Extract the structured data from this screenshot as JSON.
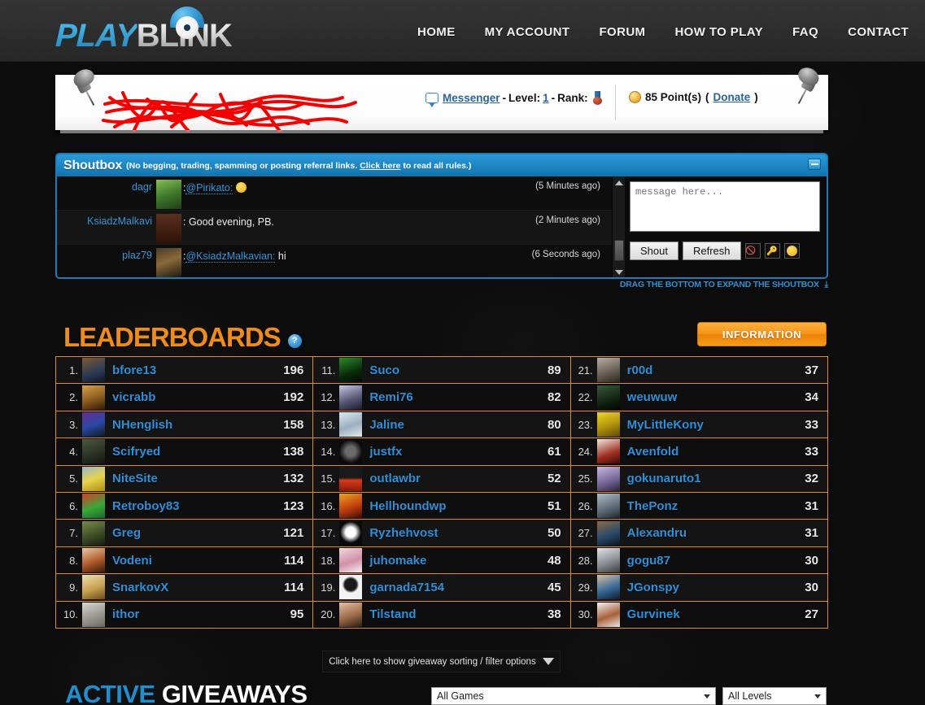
{
  "header": {
    "logo": {
      "part1": "PLAY",
      "part2": "BLINK",
      "icon": "eye-logo"
    },
    "nav": [
      {
        "label": "HOME"
      },
      {
        "label": "MY ACCOUNT"
      },
      {
        "label": "FORUM"
      },
      {
        "label": "HOW TO PLAY"
      },
      {
        "label": "FAQ"
      },
      {
        "label": "CONTACT"
      }
    ]
  },
  "userbar": {
    "username_redacted": "",
    "messenger_label": "Messenger",
    "sep1": " - ",
    "level_label": "Level:",
    "level_value": "1",
    "sep2": " - ",
    "rank_label": "Rank:",
    "points_text": "85 Point(s)",
    "donate_open": "(",
    "donate_label": "Donate",
    "donate_close": ")"
  },
  "shoutbox": {
    "title": "Shoutbox",
    "subtitle_before": "(No begging, trading, spamming or posting referral links. ",
    "subtitle_link": "Click here",
    "subtitle_after": " to read all rules.)",
    "messages": [
      {
        "user": "dagr",
        "mention": "@Pirikato:",
        "text": "",
        "emoji": "wink-smiley",
        "time": "(5 Minutes ago)",
        "avatar": "frog-avatar"
      },
      {
        "user": "KsiadzMalkavi",
        "mention": "",
        "text": "Good evening, PB.",
        "emoji": "",
        "time": "(2 Minutes ago)",
        "avatar": "dark-brown-avatar"
      },
      {
        "user": "plaz79",
        "mention": "@KsiadzMalkavian:",
        "text": " hi",
        "emoji": "",
        "time": "(6 Seconds ago)",
        "avatar": "warrior-avatar"
      }
    ],
    "input_placeholder": "message here...",
    "shout_button": "Shout",
    "refresh_button": "Refresh",
    "icons": [
      "ban-icon",
      "key-icon",
      "smiley-icon"
    ],
    "drag_hint": "DRAG THE BOTTOM TO EXPAND THE SHOUTBOX"
  },
  "leaderboards": {
    "title": "LEADERBOARDS",
    "help_glyph": "?",
    "information_button": "INFORMATION",
    "columns": [
      [
        {
          "rank": "1.",
          "name": "bfore13",
          "score": "196"
        },
        {
          "rank": "2.",
          "name": "vicrabb",
          "score": "192"
        },
        {
          "rank": "3.",
          "name": "NHenglish",
          "score": "158"
        },
        {
          "rank": "4.",
          "name": "Scifryed",
          "score": "138"
        },
        {
          "rank": "5.",
          "name": "NiteSite",
          "score": "132"
        },
        {
          "rank": "6.",
          "name": "Retroboy83",
          "score": "123"
        },
        {
          "rank": "7.",
          "name": "Greg",
          "score": "121"
        },
        {
          "rank": "8.",
          "name": "Vodeni",
          "score": "114"
        },
        {
          "rank": "9.",
          "name": "SnarkovX",
          "score": "114"
        },
        {
          "rank": "10.",
          "name": "ithor",
          "score": "95"
        }
      ],
      [
        {
          "rank": "11.",
          "name": "Suco",
          "score": "89"
        },
        {
          "rank": "12.",
          "name": "Remi76",
          "score": "82"
        },
        {
          "rank": "13.",
          "name": "Jaline",
          "score": "80"
        },
        {
          "rank": "14.",
          "name": "justfx",
          "score": "61"
        },
        {
          "rank": "15.",
          "name": "outlawbr",
          "score": "52"
        },
        {
          "rank": "16.",
          "name": "Hellhoundwp",
          "score": "51"
        },
        {
          "rank": "17.",
          "name": "Ryzhehvost",
          "score": "50"
        },
        {
          "rank": "18.",
          "name": "juhomake",
          "score": "48"
        },
        {
          "rank": "19.",
          "name": "garnada7154",
          "score": "45"
        },
        {
          "rank": "20.",
          "name": "Tilstand",
          "score": "38"
        }
      ],
      [
        {
          "rank": "21.",
          "name": "r00d",
          "score": "37"
        },
        {
          "rank": "22.",
          "name": "weuwuw",
          "score": "34"
        },
        {
          "rank": "23.",
          "name": "MyLittleKony",
          "score": "33"
        },
        {
          "rank": "24.",
          "name": "Avenfold",
          "score": "33"
        },
        {
          "rank": "25.",
          "name": "gokunaruto1",
          "score": "32"
        },
        {
          "rank": "26.",
          "name": "ThePonz",
          "score": "31"
        },
        {
          "rank": "27.",
          "name": "Alexandru",
          "score": "31"
        },
        {
          "rank": "28.",
          "name": "gogu87",
          "score": "30"
        },
        {
          "rank": "29.",
          "name": "JGonspy",
          "score": "30"
        },
        {
          "rank": "30.",
          "name": "Gurvinek",
          "score": "27"
        }
      ]
    ]
  },
  "giveaways": {
    "filter_toggle": "Click here to show giveaway sorting / filter options",
    "title_part1": "ACTIVE",
    "title_part2": "GIVEAWAYS",
    "game_select_value": "All Games",
    "level_select_value": "All Levels"
  },
  "colors": {
    "accent_orange": "#f08c1b",
    "link_blue": "#2f8fd8",
    "shoutbox_blue": "#1d7cb8",
    "page_bg": "#0c0c0c"
  }
}
